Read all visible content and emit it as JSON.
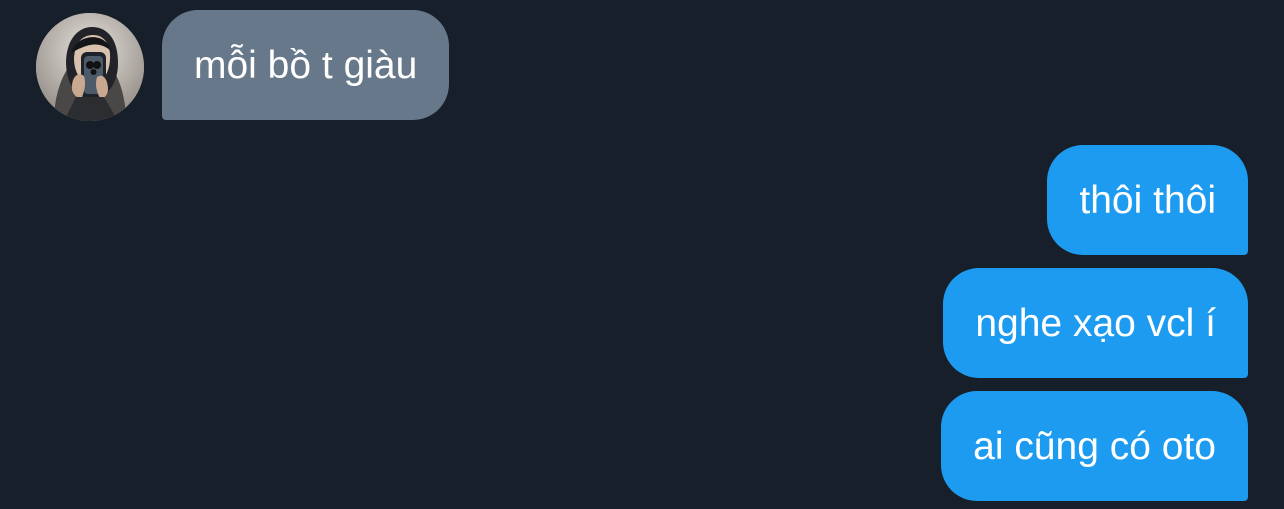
{
  "conversation": {
    "incoming": [
      {
        "text": "mỗi bồ t giàu"
      }
    ],
    "outgoing": [
      {
        "text": "thôi thôi"
      },
      {
        "text": "nghe xạo vcl í"
      },
      {
        "text": "ai cũng có oto"
      }
    ]
  },
  "theme": {
    "background": "#17202a",
    "incoming_bubble": "#66788a",
    "outgoing_bubble": "#1d9bf0",
    "text": "#ffffff"
  },
  "icons": {
    "avatar": "contact-profile-photo"
  }
}
